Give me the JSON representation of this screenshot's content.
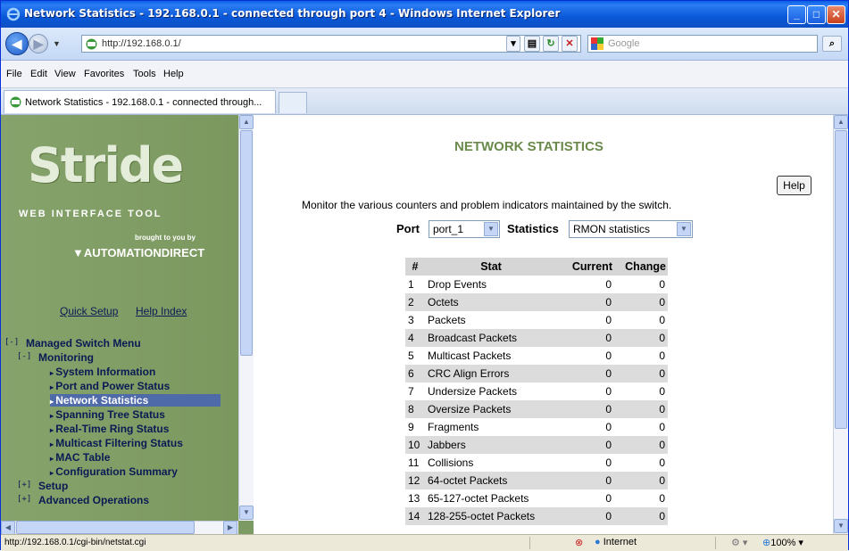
{
  "window": {
    "title": "Network Statistics - 192.168.0.1 - connected through port 4 - Windows Internet Explorer"
  },
  "address": {
    "url": "http://192.168.0.1/"
  },
  "search": {
    "placeholder": "Google"
  },
  "menu": [
    "File",
    "Edit",
    "View",
    "Favorites",
    "Tools",
    "Help"
  ],
  "tab": {
    "title": "Network Statistics - 192.168.0.1 - connected through..."
  },
  "left": {
    "logo": "Stride",
    "tagline": "WEB INTERFACE TOOL",
    "brought": "brought to you by",
    "company": "AUTOMATIONDIRECT",
    "quick_setup": "Quick Setup",
    "help_index": "Help Index",
    "menu": {
      "managed": "Managed Switch Menu",
      "monitoring": "Monitoring",
      "items": [
        "System Information",
        "Port and Power Status",
        "Network Statistics",
        "Spanning Tree Status",
        "Real-Time Ring Status",
        "Multicast Filtering Status",
        "MAC Table",
        "Configuration Summary"
      ],
      "setup": "Setup",
      "advanced": "Advanced Operations",
      "toggle_open": "[-]",
      "toggle_closed": "[+]"
    }
  },
  "main": {
    "heading": "NETWORK STATISTICS",
    "help_button": "Help",
    "description": "Monitor the various counters and problem indicators maintained by the switch.",
    "port_label": "Port",
    "port_value": "port_1",
    "stat_label": "Statistics",
    "stat_value": "RMON statistics",
    "table": {
      "headers": [
        "#",
        "Stat",
        "Current",
        "Change"
      ],
      "rows": [
        [
          "1",
          "Drop Events",
          "0",
          "0"
        ],
        [
          "2",
          "Octets",
          "0",
          "0"
        ],
        [
          "3",
          "Packets",
          "0",
          "0"
        ],
        [
          "4",
          "Broadcast Packets",
          "0",
          "0"
        ],
        [
          "5",
          "Multicast Packets",
          "0",
          "0"
        ],
        [
          "6",
          "CRC Align Errors",
          "0",
          "0"
        ],
        [
          "7",
          "Undersize Packets",
          "0",
          "0"
        ],
        [
          "8",
          "Oversize Packets",
          "0",
          "0"
        ],
        [
          "9",
          "Fragments",
          "0",
          "0"
        ],
        [
          "10",
          "Jabbers",
          "0",
          "0"
        ],
        [
          "11",
          "Collisions",
          "0",
          "0"
        ],
        [
          "12",
          "64-octet Packets",
          "0",
          "0"
        ],
        [
          "13",
          "65-127-octet Packets",
          "0",
          "0"
        ],
        [
          "14",
          "128-255-octet Packets",
          "0",
          "0"
        ]
      ]
    }
  },
  "status": {
    "url": "http://192.168.0.1/cgi-bin/netstat.cgi",
    "zone": "Internet",
    "zoom": "100%"
  }
}
